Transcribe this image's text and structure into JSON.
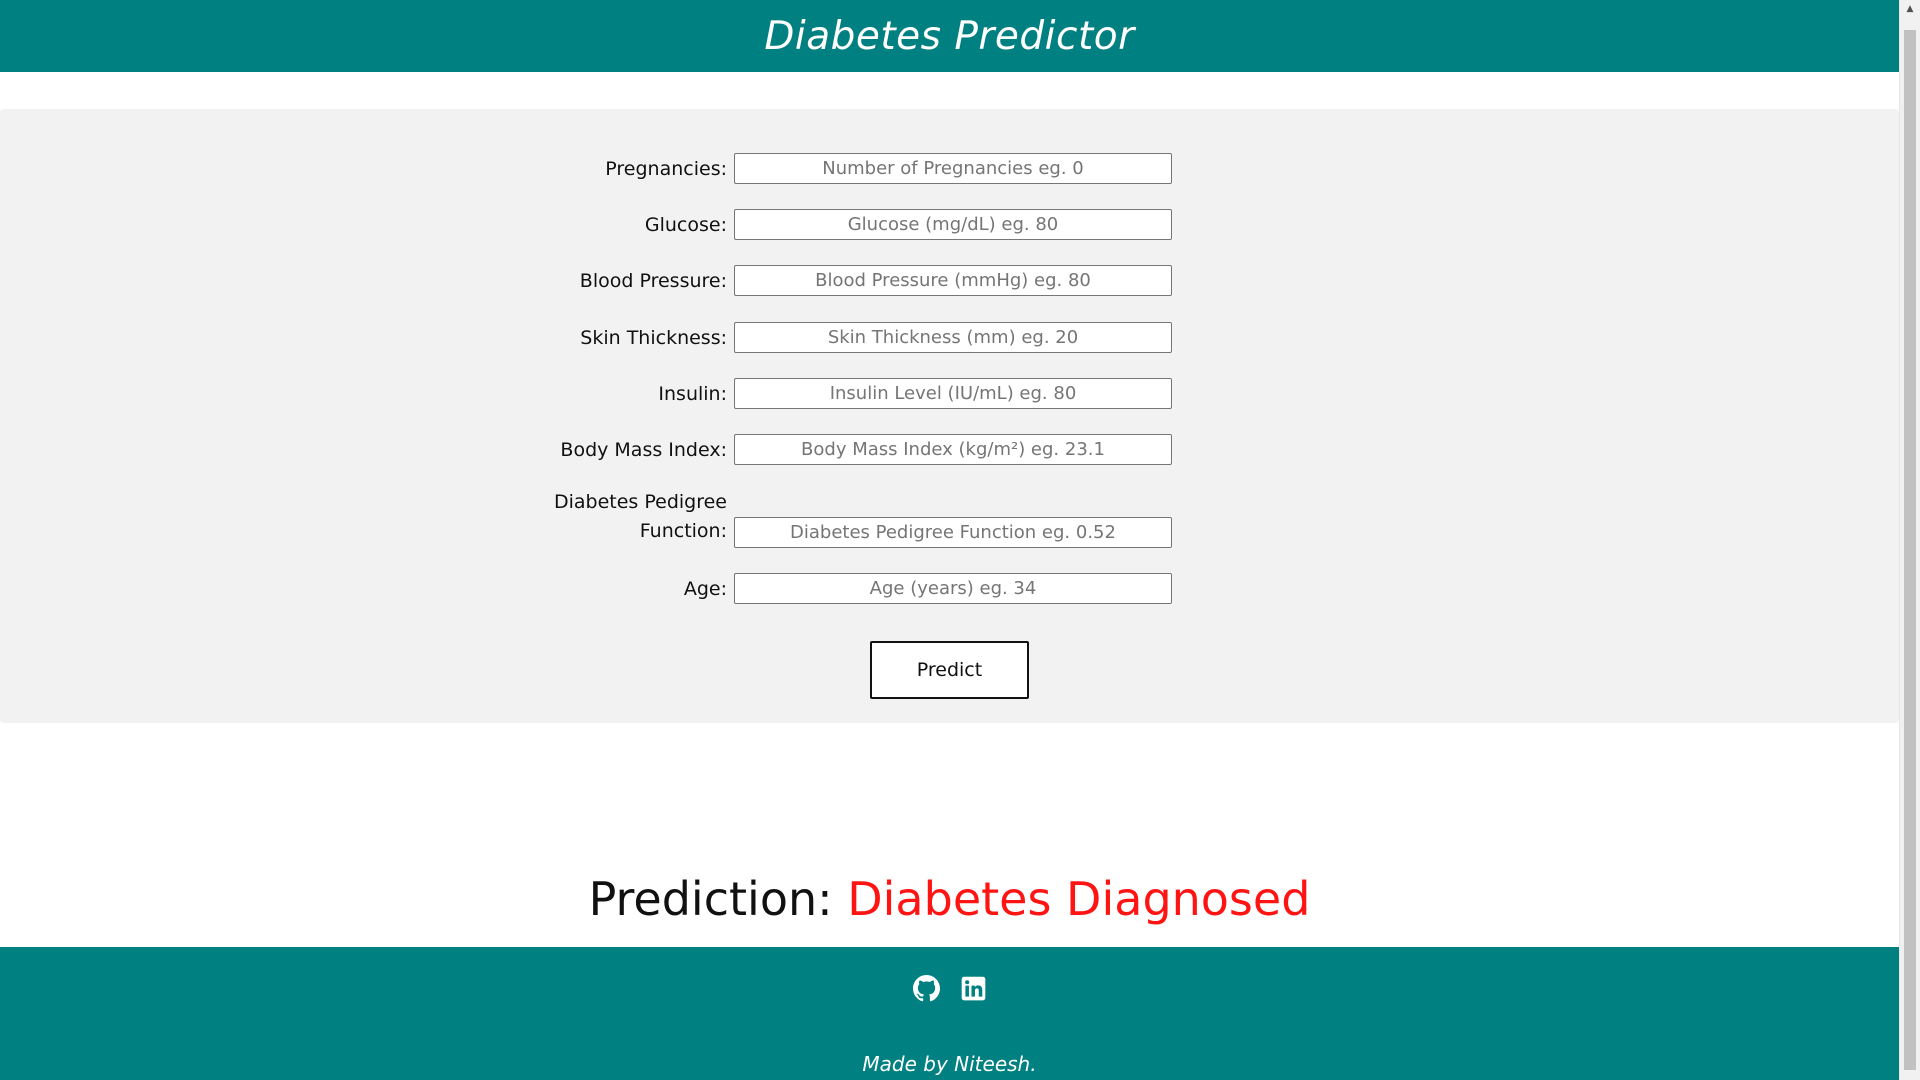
{
  "header": {
    "title": "Diabetes Predictor"
  },
  "form": {
    "fields": [
      {
        "label": "Pregnancies:",
        "placeholder": "Number of Pregnancies eg. 0"
      },
      {
        "label": "Glucose:",
        "placeholder": "Glucose (mg/dL) eg. 80"
      },
      {
        "label": "Blood Pressure:",
        "placeholder": "Blood Pressure (mmHg) eg. 80"
      },
      {
        "label": "Skin Thickness:",
        "placeholder": "Skin Thickness (mm) eg. 20"
      },
      {
        "label": "Insulin:",
        "placeholder": "Insulin Level (IU/mL) eg. 80"
      },
      {
        "label": "Body Mass Index:",
        "placeholder": "Body Mass Index (kg/m²) eg. 23.1"
      },
      {
        "label_line1": "Diabetes Pedigree",
        "label_line2": "Function:",
        "placeholder": "Diabetes Pedigree Function eg. 0.52"
      },
      {
        "label": "Age:",
        "placeholder": "Age (years) eg. 34"
      }
    ],
    "submit_label": "Predict"
  },
  "prediction": {
    "prefix": "Prediction: ",
    "result": "Diabetes Diagnosed",
    "result_color": "#ff1414"
  },
  "footer": {
    "icons": [
      "github-icon",
      "linkedin-icon"
    ],
    "credit": "Made by Niteesh."
  },
  "colors": {
    "accent": "#008080",
    "panel": "#f2f2f2"
  }
}
